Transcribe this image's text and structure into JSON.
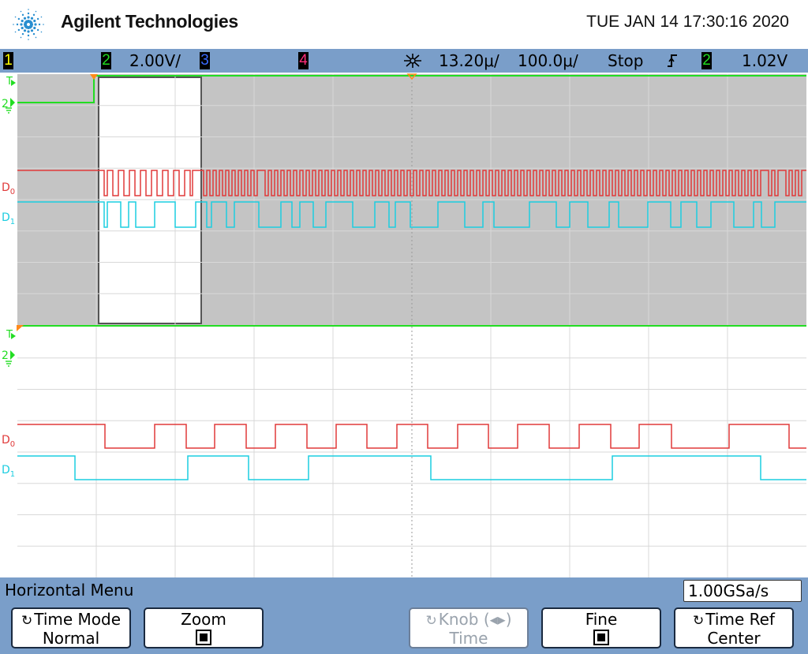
{
  "brand": {
    "name": "Agilent Technologies"
  },
  "datetime": "TUE JAN 14 17:30:16 2020",
  "status": {
    "ch1": "1",
    "ch2": "2",
    "ch2_scale": "2.00V/",
    "ch3": "3",
    "ch4": "4",
    "time_pos": "13.20μ/",
    "time_scale": "100.0μ/",
    "run_state": "Stop",
    "trig_src": "2",
    "trig_level": "1.02V"
  },
  "colors": {
    "ch1": "#ffff00",
    "ch2": "#22dd22",
    "ch3": "#3a6bff",
    "ch4": "#ff2d7a",
    "d0": "#e03a3a",
    "d1": "#1ccde0",
    "statusbar": "#7a9ec9",
    "zoom_shade": "#c4c4c4"
  },
  "screen": {
    "upper": {
      "labels": {
        "trigger": "T",
        "ch2_ground": "2",
        "d0": "D0",
        "d1": "D1"
      }
    },
    "lower": {
      "labels": {
        "trigger": "T",
        "ch2_ground": "2",
        "d0": "D0",
        "d1": "D1"
      }
    }
  },
  "menu": {
    "title": "Horizontal Menu",
    "sample_rate": "1.00GSa/s",
    "softkeys": [
      {
        "label": "Time Mode",
        "value": "Normal",
        "icon": "knob-icon",
        "enabled": true
      },
      {
        "label": "Zoom",
        "value": "checked",
        "icon": "",
        "enabled": true
      },
      {
        "label": "Knob (◂▸)",
        "value": "Time",
        "icon": "knob-icon",
        "enabled": false
      },
      {
        "label": "Fine",
        "value": "checked",
        "icon": "",
        "enabled": true
      },
      {
        "label": "Time Ref",
        "value": "Center",
        "icon": "knob-icon",
        "enabled": true
      }
    ]
  }
}
